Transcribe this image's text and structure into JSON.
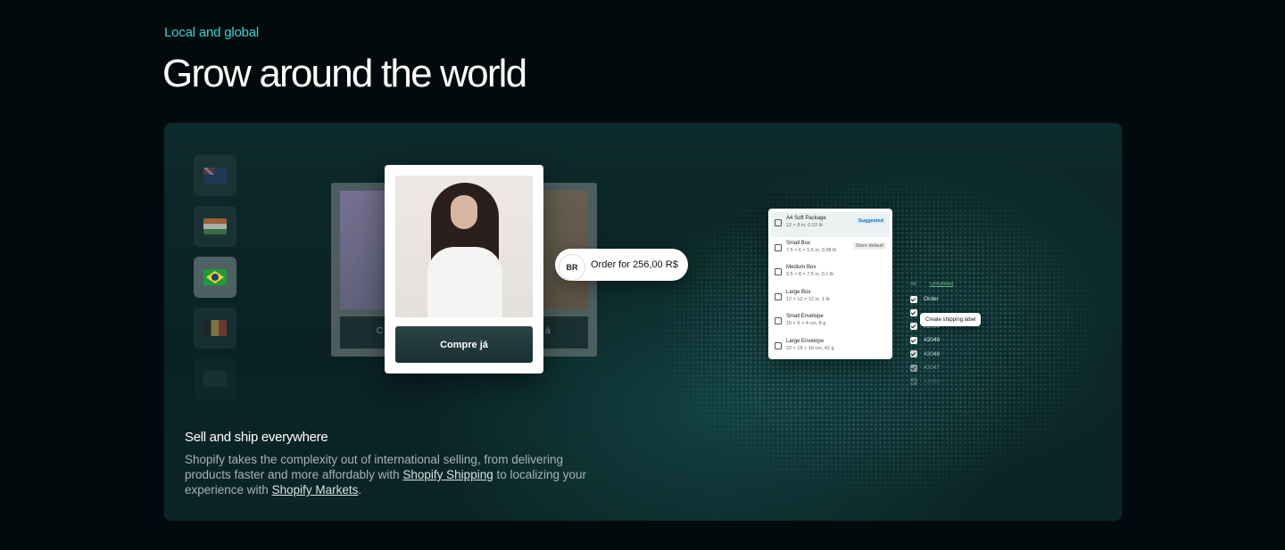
{
  "section": {
    "eyebrow": "Local and global",
    "headline": "Grow around the world"
  },
  "flags": [
    {
      "country": "Australia",
      "icon": "flag-australia-icon"
    },
    {
      "country": "India",
      "icon": "flag-india-icon"
    },
    {
      "country": "Brazil",
      "icon": "flag-brazil-icon",
      "selected": true
    },
    {
      "country": "Belgium",
      "icon": "flag-belgium-icon"
    },
    {
      "country": "Other",
      "icon": "flag-icon"
    }
  ],
  "product_card": {
    "cta_label": "Compre já",
    "back_left_label": "C",
    "back_right_label": "á"
  },
  "order_pill": {
    "badge": "BR",
    "text": "Order for 256,00 R$"
  },
  "packages": [
    {
      "name": "A4 Soft Package",
      "dims": "12 × 8 in, 0.02 lb",
      "tag": "Suggested",
      "selected": true
    },
    {
      "name": "Small Box",
      "dims": "7.5 × 6 × 5.5 in, 0.08 lb",
      "tag": "Store default"
    },
    {
      "name": "Medium Box",
      "dims": "9.5 × 8 × 7.5 in, 0.1 lb",
      "tag": ""
    },
    {
      "name": "Large Box",
      "dims": "12 × 12 × 12 in, 1 lb",
      "tag": ""
    },
    {
      "name": "Small Envelope",
      "dims": "10 × 6 × 4 cm, 8 g",
      "tag": ""
    },
    {
      "name": "Large Envelope",
      "dims": "22 × 18 × 16 cm, 42 g",
      "tag": ""
    }
  ],
  "orders": {
    "tab_all": "All",
    "tab_unfulfilled": "Unfulfilled",
    "column": "Order",
    "action": "Create shipping label",
    "rows": [
      "#2050",
      "#2049",
      "#2048",
      "#2047",
      "#2046"
    ]
  },
  "copy": {
    "title": "Sell and ship everywhere",
    "text_1": "Shopify takes the complexity out of international selling, from delivering products faster and more affordably with ",
    "link_1": "Shopify Shipping",
    "text_2": " to localizing your experience with ",
    "link_2": "Shopify Markets",
    "text_3": "."
  },
  "colors": {
    "accent": "#35d3d4",
    "background": "#020a0c",
    "panel": "#0b2527"
  }
}
